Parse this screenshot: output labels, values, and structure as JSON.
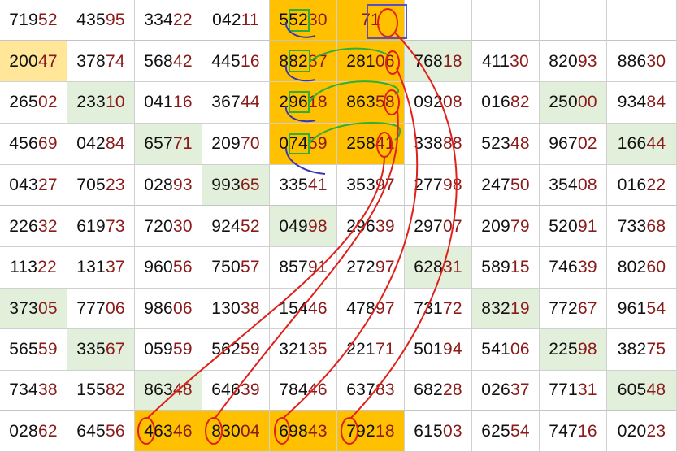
{
  "colors": {
    "orange": "#ffc000",
    "pale_yellow": "#ffe699",
    "pale_green": "#e2efda",
    "prefix_text": "#111111",
    "suffix_text": "#8b1a1a",
    "red_mark": "#e0201b",
    "green_mark": "#2fae3a",
    "blue_mark": "#5b4fc4"
  },
  "rows": [
    [
      {
        "p": "719",
        "s": "52",
        "bg": ""
      },
      {
        "p": "435",
        "s": "95",
        "bg": ""
      },
      {
        "p": "334",
        "s": "22",
        "bg": ""
      },
      {
        "p": "042",
        "s": "11",
        "bg": ""
      },
      {
        "p": "552",
        "s": "30",
        "bg": "orange"
      },
      {
        "p": "",
        "s": "71",
        "bg": "orange"
      },
      {
        "p": "",
        "s": "",
        "bg": ""
      },
      {
        "p": "",
        "s": "",
        "bg": ""
      },
      {
        "p": "",
        "s": "",
        "bg": ""
      },
      {
        "p": "",
        "s": "",
        "bg": ""
      }
    ],
    [
      {
        "p": "200",
        "s": "47",
        "bg": "pale"
      },
      {
        "p": "378",
        "s": "74",
        "bg": ""
      },
      {
        "p": "568",
        "s": "42",
        "bg": ""
      },
      {
        "p": "445",
        "s": "16",
        "bg": ""
      },
      {
        "p": "882",
        "s": "87",
        "bg": "orange"
      },
      {
        "p": "281",
        "s": "06",
        "bg": "orange"
      },
      {
        "p": "768",
        "s": "18",
        "bg": "green"
      },
      {
        "p": "411",
        "s": "30",
        "bg": ""
      },
      {
        "p": "820",
        "s": "93",
        "bg": ""
      },
      {
        "p": "886",
        "s": "30",
        "bg": ""
      }
    ],
    [
      {
        "p": "265",
        "s": "02",
        "bg": ""
      },
      {
        "p": "233",
        "s": "10",
        "bg": "green"
      },
      {
        "p": "041",
        "s": "16",
        "bg": ""
      },
      {
        "p": "367",
        "s": "44",
        "bg": ""
      },
      {
        "p": "296",
        "s": "18",
        "bg": "orange"
      },
      {
        "p": "863",
        "s": "58",
        "bg": "orange"
      },
      {
        "p": "092",
        "s": "08",
        "bg": ""
      },
      {
        "p": "016",
        "s": "82",
        "bg": ""
      },
      {
        "p": "250",
        "s": "00",
        "bg": "green"
      },
      {
        "p": "934",
        "s": "84",
        "bg": ""
      }
    ],
    [
      {
        "p": "456",
        "s": "69",
        "bg": ""
      },
      {
        "p": "042",
        "s": "84",
        "bg": ""
      },
      {
        "p": "657",
        "s": "71",
        "bg": "green"
      },
      {
        "p": "209",
        "s": "70",
        "bg": ""
      },
      {
        "p": "074",
        "s": "59",
        "bg": "orange"
      },
      {
        "p": "258",
        "s": "41",
        "bg": "orange"
      },
      {
        "p": "338",
        "s": "88",
        "bg": ""
      },
      {
        "p": "523",
        "s": "48",
        "bg": ""
      },
      {
        "p": "967",
        "s": "02",
        "bg": ""
      },
      {
        "p": "166",
        "s": "44",
        "bg": "green"
      }
    ],
    [
      {
        "p": "043",
        "s": "27",
        "bg": ""
      },
      {
        "p": "705",
        "s": "23",
        "bg": ""
      },
      {
        "p": "028",
        "s": "93",
        "bg": ""
      },
      {
        "p": "993",
        "s": "65",
        "bg": "green"
      },
      {
        "p": "335",
        "s": "41",
        "bg": ""
      },
      {
        "p": "353",
        "s": "97",
        "bg": ""
      },
      {
        "p": "277",
        "s": "98",
        "bg": ""
      },
      {
        "p": "247",
        "s": "50",
        "bg": ""
      },
      {
        "p": "354",
        "s": "08",
        "bg": ""
      },
      {
        "p": "016",
        "s": "22",
        "bg": ""
      }
    ],
    [
      {
        "p": "226",
        "s": "32",
        "bg": ""
      },
      {
        "p": "619",
        "s": "73",
        "bg": ""
      },
      {
        "p": "720",
        "s": "30",
        "bg": ""
      },
      {
        "p": "924",
        "s": "52",
        "bg": ""
      },
      {
        "p": "049",
        "s": "98",
        "bg": "green"
      },
      {
        "p": "296",
        "s": "39",
        "bg": ""
      },
      {
        "p": "297",
        "s": "07",
        "bg": ""
      },
      {
        "p": "209",
        "s": "79",
        "bg": ""
      },
      {
        "p": "520",
        "s": "91",
        "bg": ""
      },
      {
        "p": "733",
        "s": "68",
        "bg": ""
      }
    ],
    [
      {
        "p": "113",
        "s": "22",
        "bg": ""
      },
      {
        "p": "131",
        "s": "37",
        "bg": ""
      },
      {
        "p": "960",
        "s": "56",
        "bg": ""
      },
      {
        "p": "750",
        "s": "57",
        "bg": ""
      },
      {
        "p": "857",
        "s": "91",
        "bg": ""
      },
      {
        "p": "272",
        "s": "97",
        "bg": ""
      },
      {
        "p": "628",
        "s": "31",
        "bg": "green"
      },
      {
        "p": "589",
        "s": "15",
        "bg": ""
      },
      {
        "p": "746",
        "s": "39",
        "bg": ""
      },
      {
        "p": "802",
        "s": "60",
        "bg": ""
      }
    ],
    [
      {
        "p": "373",
        "s": "05",
        "bg": "green"
      },
      {
        "p": "777",
        "s": "06",
        "bg": ""
      },
      {
        "p": "986",
        "s": "06",
        "bg": ""
      },
      {
        "p": "130",
        "s": "38",
        "bg": ""
      },
      {
        "p": "154",
        "s": "46",
        "bg": ""
      },
      {
        "p": "478",
        "s": "97",
        "bg": ""
      },
      {
        "p": "731",
        "s": "72",
        "bg": ""
      },
      {
        "p": "832",
        "s": "19",
        "bg": "green"
      },
      {
        "p": "772",
        "s": "67",
        "bg": ""
      },
      {
        "p": "961",
        "s": "54",
        "bg": ""
      }
    ],
    [
      {
        "p": "565",
        "s": "59",
        "bg": ""
      },
      {
        "p": "335",
        "s": "67",
        "bg": "green"
      },
      {
        "p": "059",
        "s": "59",
        "bg": ""
      },
      {
        "p": "562",
        "s": "59",
        "bg": ""
      },
      {
        "p": "321",
        "s": "35",
        "bg": ""
      },
      {
        "p": "221",
        "s": "71",
        "bg": ""
      },
      {
        "p": "501",
        "s": "94",
        "bg": ""
      },
      {
        "p": "541",
        "s": "06",
        "bg": ""
      },
      {
        "p": "225",
        "s": "98",
        "bg": "green"
      },
      {
        "p": "382",
        "s": "75",
        "bg": ""
      }
    ],
    [
      {
        "p": "734",
        "s": "38",
        "bg": ""
      },
      {
        "p": "155",
        "s": "82",
        "bg": ""
      },
      {
        "p": "863",
        "s": "48",
        "bg": "green"
      },
      {
        "p": "646",
        "s": "39",
        "bg": ""
      },
      {
        "p": "784",
        "s": "46",
        "bg": ""
      },
      {
        "p": "637",
        "s": "83",
        "bg": ""
      },
      {
        "p": "682",
        "s": "28",
        "bg": ""
      },
      {
        "p": "026",
        "s": "37",
        "bg": ""
      },
      {
        "p": "771",
        "s": "31",
        "bg": ""
      },
      {
        "p": "605",
        "s": "48",
        "bg": "green"
      }
    ],
    [
      {
        "p": "028",
        "s": "62",
        "bg": ""
      },
      {
        "p": "645",
        "s": "56",
        "bg": ""
      },
      {
        "p": "463",
        "s": "46",
        "bg": "orange"
      },
      {
        "p": "830",
        "s": "04",
        "bg": "orange"
      },
      {
        "p": "698",
        "s": "43",
        "bg": "orange"
      },
      {
        "p": "792",
        "s": "18",
        "bg": "orange"
      },
      {
        "p": "615",
        "s": "03",
        "bg": ""
      },
      {
        "p": "625",
        "s": "54",
        "bg": ""
      },
      {
        "p": "747",
        "s": "16",
        "bg": ""
      },
      {
        "p": "020",
        "s": "23",
        "bg": ""
      }
    ]
  ]
}
